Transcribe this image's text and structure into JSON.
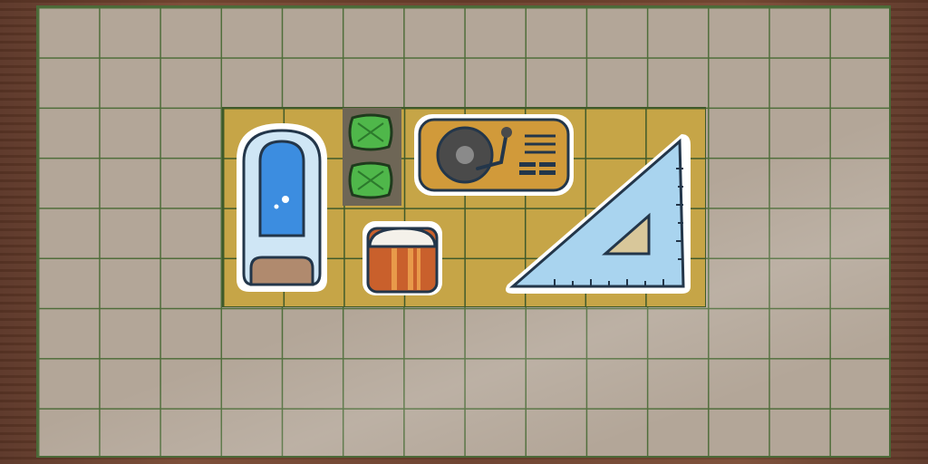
{
  "board": {
    "columns": 14,
    "rows": 9,
    "active_region": {
      "columns": 8,
      "rows": 4
    }
  },
  "colors": {
    "table_wood": "#6b3f2c",
    "board_cell": "#b3a698",
    "grid_line": "#4f6d3a",
    "active_cell": "#c6a547",
    "occupied_cell": "#6e6656"
  },
  "items": [
    {
      "name": "phone-booth-shower",
      "icon": "shower-capsule-icon"
    },
    {
      "name": "green-pillow-top",
      "icon": "green-pillow-icon"
    },
    {
      "name": "green-pillow-bottom",
      "icon": "green-pillow-icon"
    },
    {
      "name": "turntable",
      "icon": "record-player-icon"
    },
    {
      "name": "ottoman",
      "icon": "striped-ottoman-icon"
    },
    {
      "name": "set-square",
      "icon": "triangle-ruler-icon"
    }
  ]
}
